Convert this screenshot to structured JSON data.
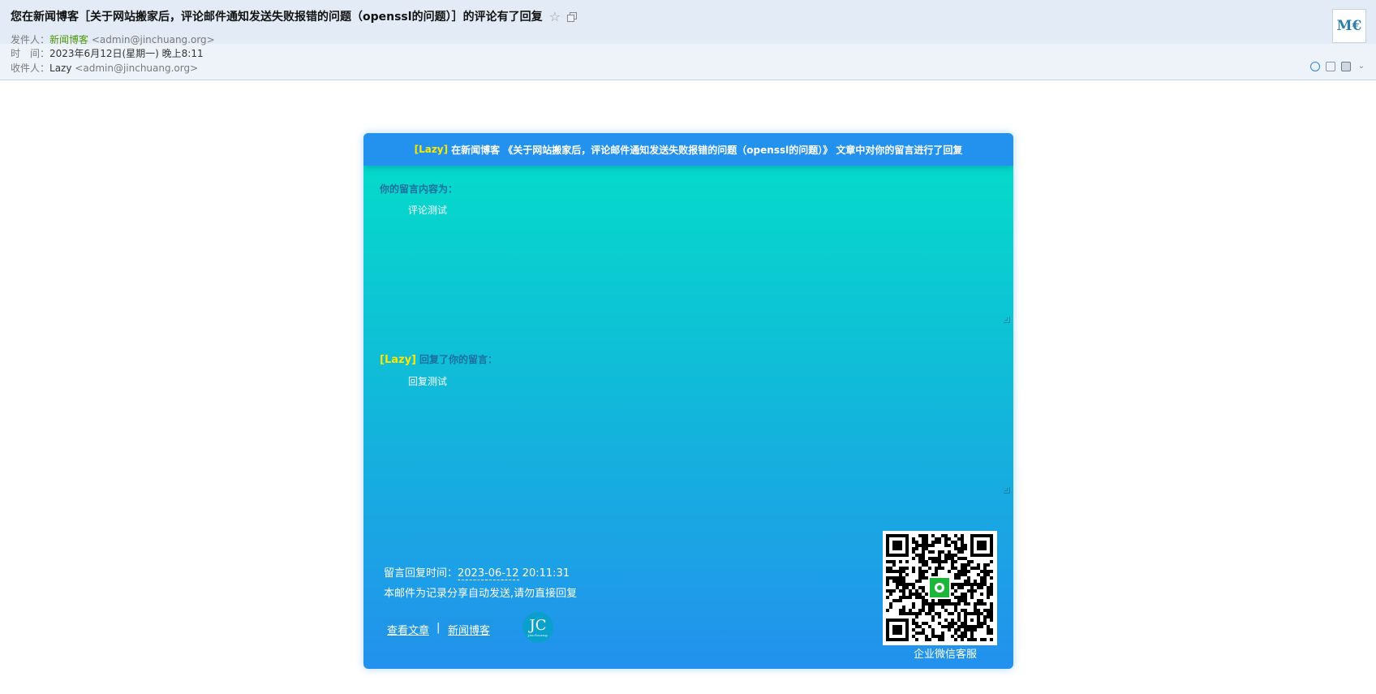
{
  "mail": {
    "subject": "您在新闻博客［关于网站搬家后，评论邮件通知发送失败报错的问题（openssl的问题）］的评论有了回复",
    "star_icon": "☆",
    "from_label": "发件人：",
    "from_name": "新闻博客",
    "from_addr": "<admin@jinchuang.org>",
    "time_label": "时　间：",
    "time_value": "2023年6月12日(星期一) 晚上8:11",
    "to_label": "收件人：",
    "to_name": "Lazy",
    "to_addr": "<admin@jinchuang.org>",
    "avatar_text": "M€"
  },
  "card": {
    "header_name": "[Lazy]",
    "header_text": "在新闻博客 《关于网站搬家后，评论邮件通知发送失败报错的问题（openssl的问题）》 文章中对你的留言进行了回复",
    "comment_label": "你的留言内容为：",
    "comment_text": "评论测试",
    "reply_name": "[Lazy]",
    "reply_label": "回复了你的留言：",
    "reply_text": "回复测试",
    "reply_time_label": "留言回复时间：",
    "reply_time_date": "2023-06-12",
    "reply_time_clock": "20:11:31",
    "auto_notice": "本邮件为记录分享自动发送,请勿直接回复",
    "view_article_link": "查看文章",
    "separator": "|",
    "blog_link": "新闻博客",
    "logo_text": "JC",
    "logo_subtext": "jinchuang",
    "qr_caption": "企业微信客服"
  },
  "colors": {
    "header_blue": "#2391ee",
    "gradient_top": "#03dfc8",
    "gradient_bottom": "#2391ee",
    "highlight_yellow": "#ffe600",
    "sender_green": "#4f9a0e"
  }
}
